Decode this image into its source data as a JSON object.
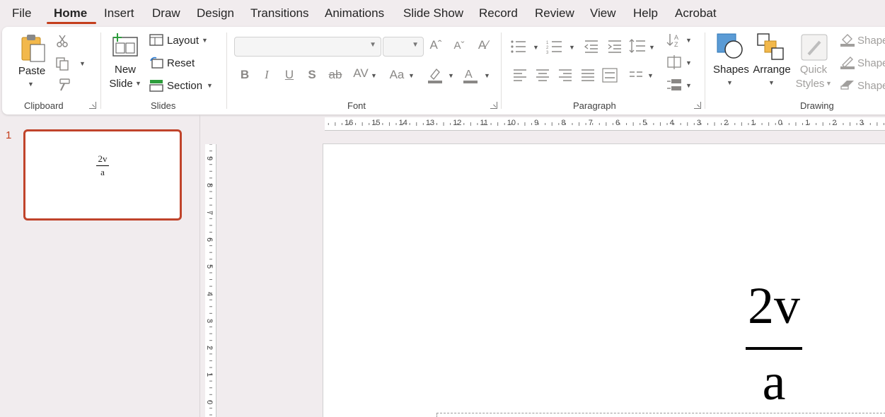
{
  "tabs": [
    "File",
    "Home",
    "Insert",
    "Draw",
    "Design",
    "Transitions",
    "Animations",
    "Slide Show",
    "Record",
    "Review",
    "View",
    "Help",
    "Acrobat"
  ],
  "active_tab": "Home",
  "ribbon": {
    "clipboard": {
      "label": "Clipboard",
      "paste": "Paste"
    },
    "slides": {
      "label": "Slides",
      "new_slide_1": "New",
      "new_slide_2": "Slide",
      "layout": "Layout",
      "reset": "Reset",
      "section": "Section"
    },
    "font": {
      "label": "Font",
      "font_name": "",
      "font_size": ""
    },
    "paragraph": {
      "label": "Paragraph"
    },
    "drawing": {
      "label": "Drawing",
      "shapes": "Shapes",
      "arrange": "Arrange",
      "quick_1": "Quick",
      "quick_2": "Styles",
      "shape_fill": "Shape",
      "shape_outline": "Shape",
      "shape_effects": "Shape"
    }
  },
  "thumbnails": [
    {
      "number": "1",
      "numerator": "2v",
      "denominator": "a"
    }
  ],
  "slide": {
    "numerator": "2v",
    "denominator": "a"
  },
  "hruler": [
    "16",
    "15",
    "14",
    "13",
    "12",
    "11",
    "10",
    "9",
    "8",
    "7",
    "6",
    "5",
    "4",
    "3",
    "2",
    "1",
    "0",
    "1",
    "2",
    "3"
  ],
  "vruler": [
    "9",
    "8",
    "7",
    "6",
    "5",
    "4",
    "3",
    "2",
    "1",
    "0"
  ],
  "colors": {
    "accent": "#c43e1c",
    "thumb_border": "#c0442b"
  }
}
